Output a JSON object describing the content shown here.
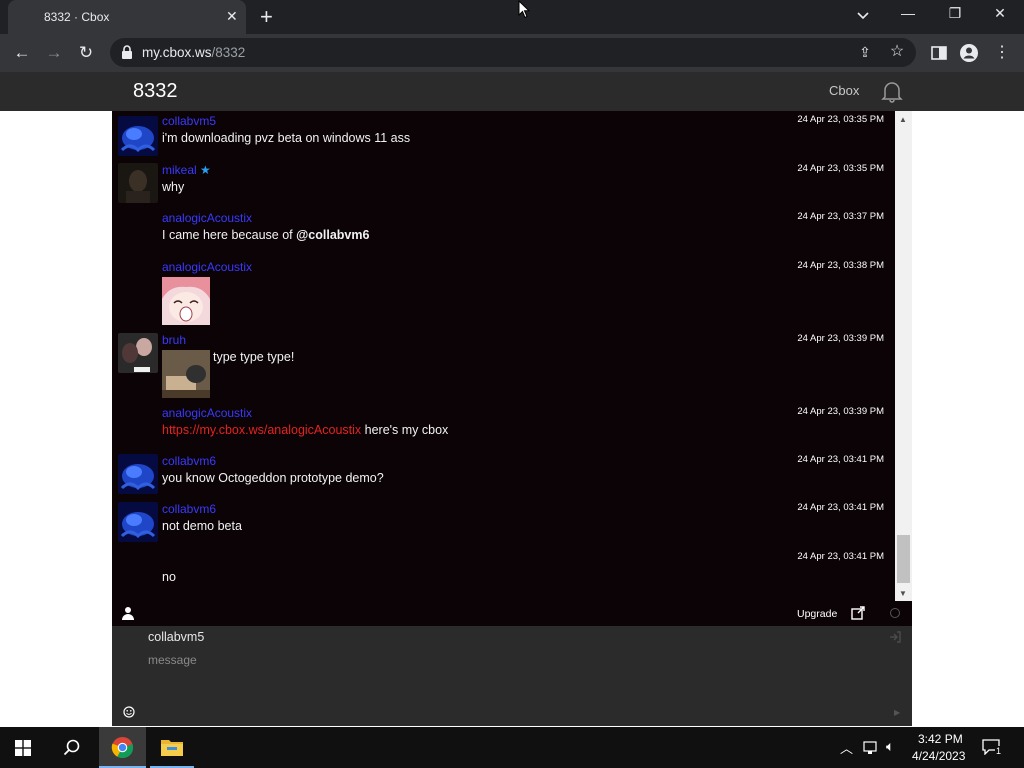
{
  "browser": {
    "tab_title": "8332 · Cbox",
    "url_host": "my.cbox.ws",
    "url_path": "/8332"
  },
  "header": {
    "room_title": "8332",
    "brand": "Cbox"
  },
  "messages": [
    {
      "nick": "collabvm5",
      "time": "24 Apr 23, 03:35 PM",
      "text": "i'm downloading pvz beta on windows 11 ass"
    },
    {
      "nick": "mikeal",
      "time": "24 Apr 23, 03:35 PM",
      "text": "why"
    },
    {
      "nick": "analogicAcoustix",
      "time": "24 Apr 23, 03:37 PM",
      "text": "I came here because of ",
      "mention": "@collabvm6"
    },
    {
      "nick": "analogicAcoustix",
      "time": "24 Apr 23, 03:38 PM",
      "image": "anime-face-sticker"
    },
    {
      "nick": "bruh",
      "time": "24 Apr 23, 03:39 PM",
      "text": "type type type!",
      "image": "cat-typing-photo"
    },
    {
      "nick": "analogicAcoustix",
      "time": "24 Apr 23, 03:39 PM",
      "link": "https://my.cbox.ws/analogicAcoustix",
      "text": " here's my cbox"
    },
    {
      "nick": "collabvm6",
      "time": "24 Apr 23, 03:41 PM",
      "text": "you know Octogeddon prototype demo?"
    },
    {
      "nick": "collabvm6",
      "time": "24 Apr 23, 03:41 PM",
      "text": "not demo beta"
    },
    {
      "nick": "",
      "time": "24 Apr 23, 03:41 PM",
      "text": "no"
    }
  ],
  "bar": {
    "upgrade_label": "Upgrade"
  },
  "input": {
    "name_value": "collabvm5",
    "message_placeholder": "message"
  },
  "taskbar": {
    "time": "3:42 PM",
    "date": "4/24/2023",
    "notification_count": "1"
  },
  "colors": {
    "chat_bg": "#0b0305",
    "nick": "#3a3aff",
    "link": "#e52222",
    "header_bg": "#2b2b2b"
  }
}
